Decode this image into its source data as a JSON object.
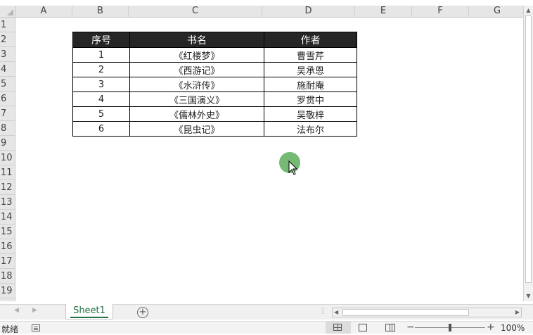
{
  "columns": [
    "A",
    "B",
    "C",
    "D",
    "E",
    "F",
    "G"
  ],
  "rows": [
    "1",
    "2",
    "3",
    "4",
    "5",
    "6",
    "7",
    "8",
    "9",
    "10",
    "11",
    "12",
    "13",
    "14",
    "15",
    "16",
    "17",
    "18",
    "19"
  ],
  "table": {
    "headers": [
      "序号",
      "书名",
      "作者"
    ],
    "rows": [
      [
        "1",
        "《红楼梦》",
        "曹雪芹"
      ],
      [
        "2",
        "《西游记》",
        "吴承恩"
      ],
      [
        "3",
        "《水浒传》",
        "施耐庵"
      ],
      [
        "4",
        "《三国演义》",
        "罗贯中"
      ],
      [
        "5",
        "《儒林外史》",
        "吴敬梓"
      ],
      [
        "6",
        "《昆虫记》",
        "法布尔"
      ]
    ]
  },
  "sheet_tab": "Sheet1",
  "status": {
    "text": "就绪",
    "zoom": "100%"
  },
  "icons": {
    "add_sheet": "plus-circle-icon",
    "macro": "macro-record-icon",
    "view_normal": "normal-view-icon",
    "view_page_layout": "page-layout-icon",
    "view_page_break": "page-break-icon"
  },
  "colors": {
    "header_bg": "#262626",
    "accent": "#217346",
    "cursor": "#6db56d"
  }
}
